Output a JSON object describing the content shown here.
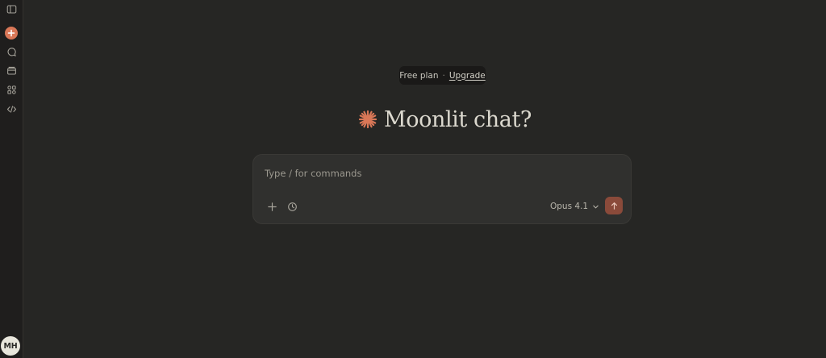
{
  "sidebar": {
    "items": [
      {
        "icon": "sidebar-toggle-icon"
      },
      {
        "icon": "plus-icon"
      },
      {
        "icon": "chats-icon"
      },
      {
        "icon": "projects-icon"
      },
      {
        "icon": "artifacts-icon"
      },
      {
        "icon": "code-icon"
      }
    ],
    "avatar_initials": "MH"
  },
  "plan": {
    "label": "Free plan",
    "separator": "·",
    "upgrade_label": "Upgrade"
  },
  "greeting": {
    "text": "Moonlit chat?"
  },
  "composer": {
    "placeholder": "Type / for commands",
    "value": "",
    "model_label": "Opus 4.1"
  },
  "colors": {
    "background": "#262624",
    "sidebar": "#1f1e1d",
    "accent": "#d97757",
    "send_button": "#8a4a3a",
    "composer": "#30302e"
  }
}
